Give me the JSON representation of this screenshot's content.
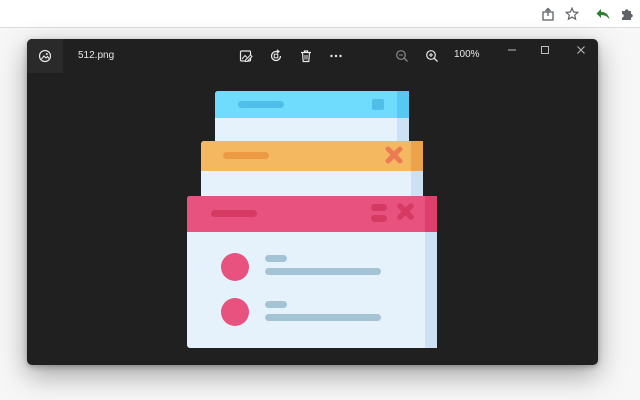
{
  "browser": {
    "icons": [
      "share-icon",
      "star-icon",
      "back-arrow-icon",
      "extensions-icon"
    ]
  },
  "viewer": {
    "file_name": "512.png",
    "zoom_level": "100%",
    "toolbar_icons": [
      "edit-image-icon",
      "rotate-icon",
      "delete-icon",
      "more-icon",
      "zoom-out-icon",
      "zoom-in-icon"
    ],
    "window_controls": [
      "minimize-icon",
      "maximize-icon",
      "close-icon"
    ]
  },
  "colors": {
    "window_bg": "#202020",
    "card_blue_header": "#6fdcfd",
    "card_orange_header": "#f4b860",
    "card_pink_header": "#e8527e",
    "card_body": "#e5f1fb",
    "avatar": "#e8527e"
  }
}
